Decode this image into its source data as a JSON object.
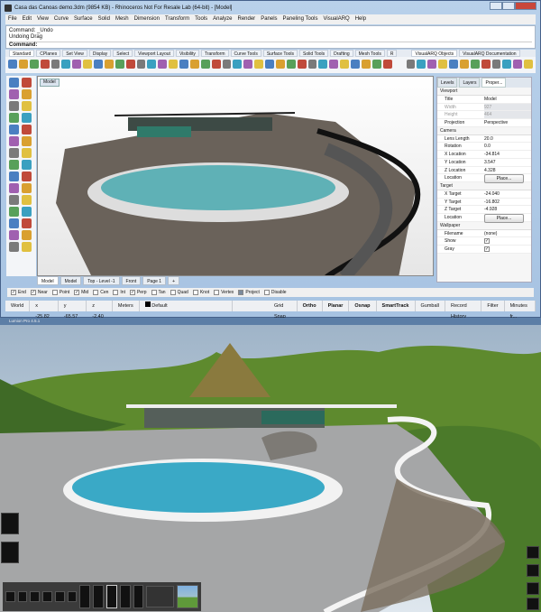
{
  "rhino": {
    "title": "Casa das Canoas demo.3dm (9854 KB) - Rhinoceros Not For Resale Lab (64-bit) - [Model]",
    "menu": [
      "File",
      "Edit",
      "View",
      "Curve",
      "Surface",
      "Solid",
      "Mesh",
      "Dimension",
      "Transform",
      "Tools",
      "Analyze",
      "Render",
      "Panels",
      "Paneling Tools",
      "VisualARQ",
      "Help"
    ],
    "command_history": [
      "Command: _Undo",
      "Undoing Drag"
    ],
    "command_prompt": "Command:",
    "toolbar_tabs": [
      "Standard",
      "CPlanes",
      "Set View",
      "Display",
      "Select",
      "Viewport Layout",
      "Visibility",
      "Transform",
      "Curve Tools",
      "Surface Tools",
      "Solid Tools",
      "Drafting",
      "Mesh Tools",
      "R"
    ],
    "toolbar_tabs_right": [
      "VisualARQ Objects",
      "VisualARQ Documentation"
    ],
    "viewport_label": "Model",
    "viewport_tabs": [
      "Model",
      "Model",
      "Top - Level -1",
      "Front",
      "Page 1",
      "+"
    ],
    "panel": {
      "tabs": [
        "Levels",
        "Layers",
        "Proper..."
      ],
      "sections": [
        {
          "title": "Viewport",
          "rows": [
            [
              "Title",
              "Model"
            ],
            [
              "Width",
              "927"
            ],
            [
              "Height",
              "464"
            ],
            [
              "Projection",
              "Perspective"
            ]
          ]
        },
        {
          "title": "Camera",
          "rows": [
            [
              "Lens Length",
              "20.0"
            ],
            [
              "Rotation",
              "0.0"
            ],
            [
              "X Location",
              "-34.814"
            ],
            [
              "Y Location",
              "3.547"
            ],
            [
              "Z Location",
              "4.328"
            ],
            [
              "Location",
              "Place..."
            ]
          ]
        },
        {
          "title": "Target",
          "rows": [
            [
              "X Target",
              "-24.040"
            ],
            [
              "Y Target",
              "-16.802"
            ],
            [
              "Z Target",
              "-4.928"
            ],
            [
              "Location",
              "Place..."
            ]
          ]
        },
        {
          "title": "Wallpaper",
          "rows": [
            [
              "Filename",
              "(none)"
            ],
            [
              "Show",
              "✓"
            ],
            [
              "Gray",
              "✓"
            ]
          ]
        }
      ]
    },
    "osnap": [
      {
        "label": "End",
        "checked": true
      },
      {
        "label": "Near",
        "checked": true
      },
      {
        "label": "Point",
        "checked": false
      },
      {
        "label": "Mid",
        "checked": true
      },
      {
        "label": "Cen",
        "checked": false
      },
      {
        "label": "Int",
        "checked": false
      },
      {
        "label": "Perp",
        "checked": true
      },
      {
        "label": "Tan",
        "checked": false
      },
      {
        "label": "Quad",
        "checked": false
      },
      {
        "label": "Knot",
        "checked": false
      },
      {
        "label": "Vertex",
        "checked": false
      },
      {
        "label": "Project",
        "checked": false
      },
      {
        "label": "Disable",
        "checked": false
      }
    ],
    "status": {
      "cplane": "World",
      "x": "x -25.82",
      "y": "y -65.57",
      "z": "z -2.40",
      "units": "Meters",
      "layer": "Default",
      "toggles": [
        "Grid Snap",
        "Ortho",
        "Planar",
        "Osnap",
        "SmartTrack",
        "Gumball",
        "Record History",
        "Filter",
        "Minutes fr..."
      ],
      "bold_toggles": [
        "Ortho",
        "Planar",
        "Osnap",
        "SmartTrack"
      ]
    }
  },
  "lumion": {
    "title": "Lumion Pro 4.5.1"
  },
  "colors": {
    "accent": "#3c6fa8",
    "pool": "#4fb6c8",
    "grass": "#5e8a2e"
  }
}
